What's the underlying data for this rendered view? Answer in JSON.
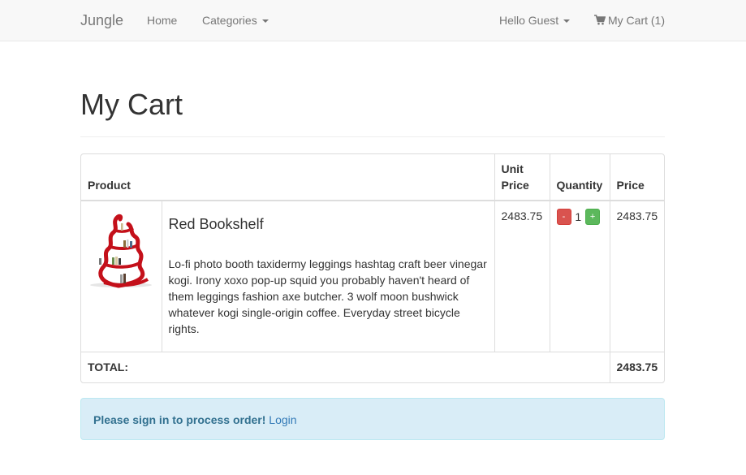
{
  "navbar": {
    "brand": "Jungle",
    "home": "Home",
    "categories": "Categories",
    "user_menu": "Hello Guest",
    "cart": "My Cart (1)"
  },
  "page": {
    "title": "My Cart"
  },
  "table": {
    "headers": {
      "product": "Product",
      "unit_price": "Unit Price",
      "quantity": "Quantity",
      "price": "Price"
    },
    "items": [
      {
        "image": "red-bookshelf-image",
        "name": "Red Bookshelf",
        "description": "Lo-fi photo booth taxidermy leggings hashtag craft beer vinegar kogi. Irony xoxo pop-up squid you probably haven't heard of them leggings fashion axe butcher. 3 wolf moon bushwick whatever kogi single-origin coffee. Everyday street bicycle rights.",
        "unit_price": "2483.75",
        "quantity": "1",
        "decrease_label": "-",
        "increase_label": "+",
        "price": "2483.75"
      }
    ],
    "total_label": "TOTAL:",
    "total_value": "2483.75"
  },
  "alert": {
    "message": "Please sign in to process order!",
    "link": "Login"
  },
  "colors": {
    "navbar_bg": "#f8f8f8",
    "decrease_button": "#d9534f",
    "increase_button": "#5cb85c",
    "alert_bg": "#d9edf7",
    "alert_text": "#31708f",
    "link": "#337ab7",
    "product_red": "#c4101a"
  }
}
